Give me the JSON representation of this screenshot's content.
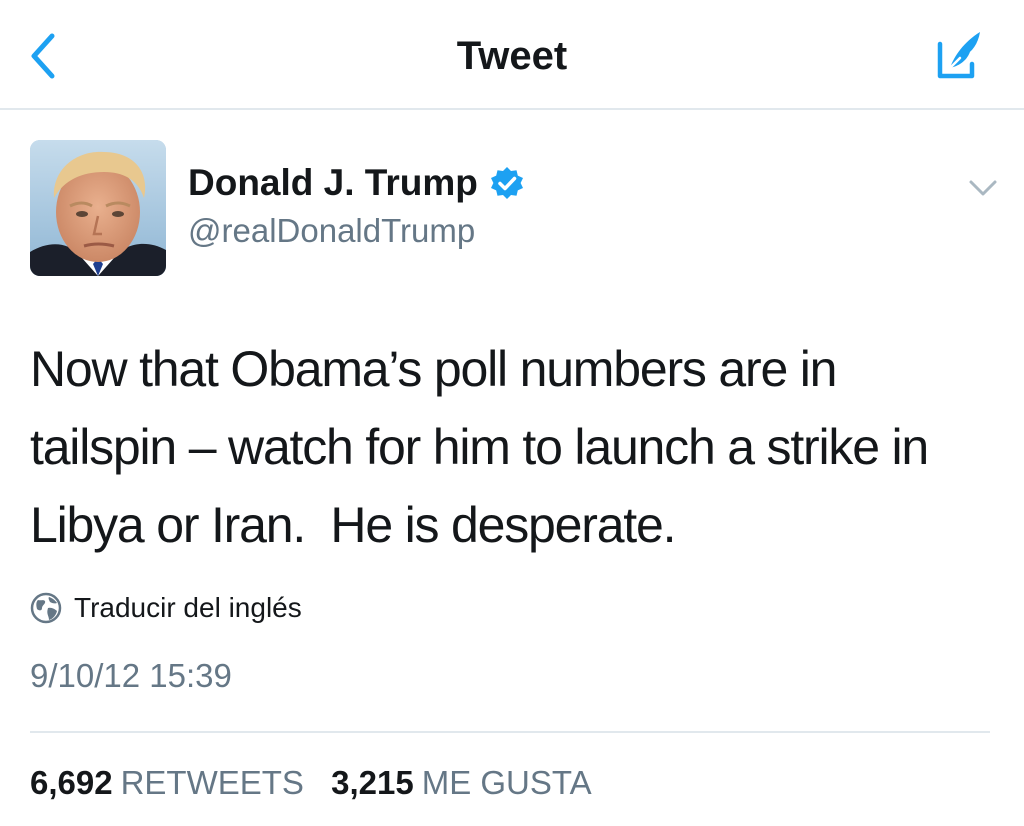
{
  "nav": {
    "title": "Tweet",
    "back_icon": "chevron-left-icon",
    "compose_icon": "compose-tweet-icon",
    "accent_color": "#1da1f2"
  },
  "author": {
    "name": "Donald J. Trump",
    "handle": "@realDonaldTrump",
    "verified": true,
    "verified_color": "#1da1f2"
  },
  "tweet": {
    "text": "Now that Obama’s poll numbers are in tailspin – watch for him to launch a strike in Libya or Iran.  He is desperate.",
    "translate_label": "Traducir del inglés",
    "timestamp": "9/10/12 15:39"
  },
  "stats": {
    "retweets_count": "6,692",
    "retweets_label": "RETWEETS",
    "likes_count": "3,215",
    "likes_label": "ME GUSTA"
  }
}
